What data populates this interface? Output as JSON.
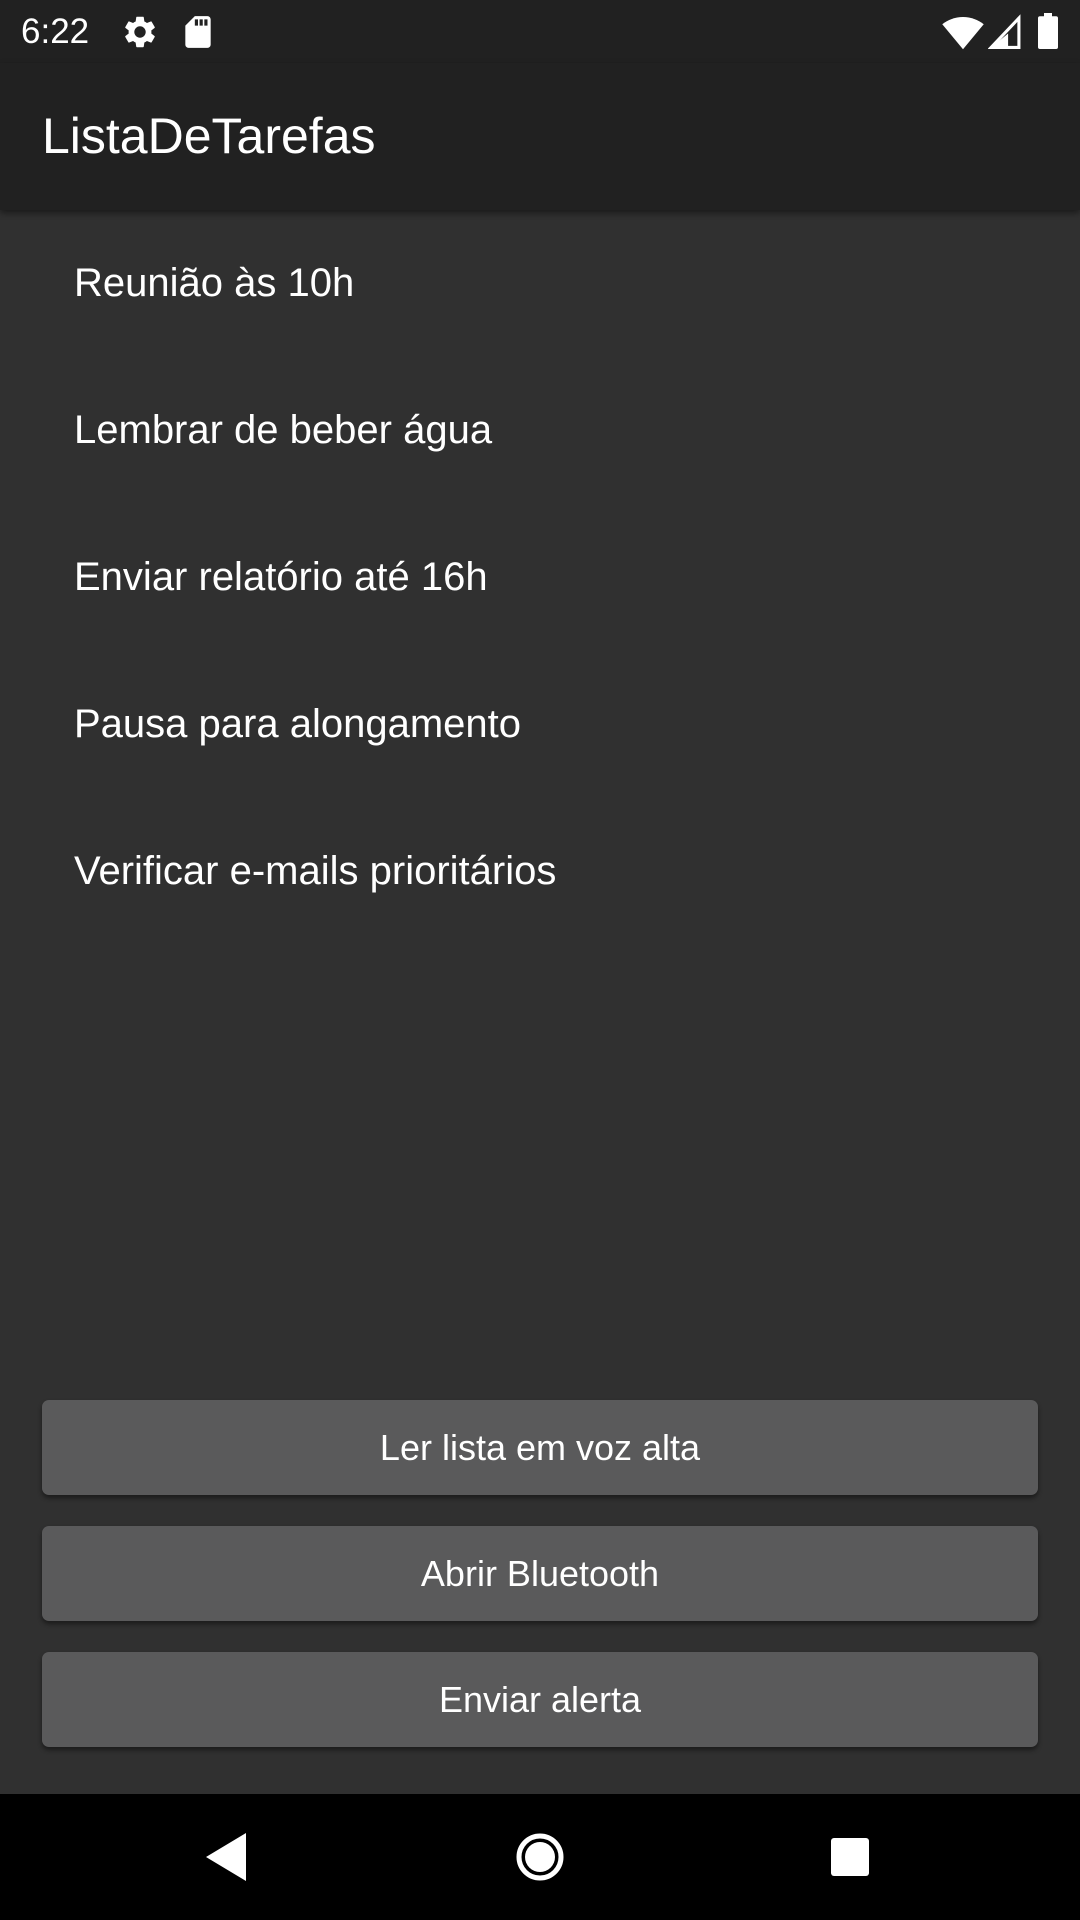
{
  "status_bar": {
    "time": "6:22",
    "icons_left": [
      "gear-icon",
      "sd-card-icon"
    ],
    "icons_right": [
      "wifi-icon",
      "cell-signal-icon",
      "battery-icon"
    ]
  },
  "app_bar": {
    "title": "ListaDeTarefas"
  },
  "tasks": [
    {
      "label": "Reunião às 10h"
    },
    {
      "label": "Lembrar de beber água"
    },
    {
      "label": "Enviar relatório até 16h"
    },
    {
      "label": "Pausa para alongamento"
    },
    {
      "label": "Verificar e-mails prioritários"
    }
  ],
  "buttons": {
    "read_aloud": "Ler lista em voz alta",
    "open_bluetooth": "Abrir Bluetooth",
    "send_alert": "Enviar alerta"
  },
  "nav_bar": {
    "icons": [
      "back-icon",
      "home-icon",
      "recents-icon"
    ]
  },
  "colors": {
    "background": "#303030",
    "app_bar": "#212121",
    "button": "#5a5a5b",
    "text": "#ffffff",
    "nav_bar": "#000000"
  }
}
